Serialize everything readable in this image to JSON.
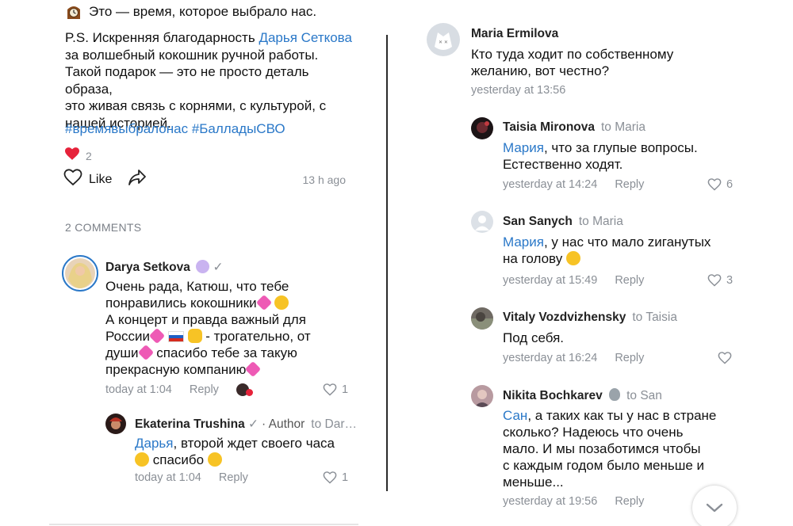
{
  "post": {
    "line_clock": "Это — время, которое выбрало нас.",
    "ps_prefix": "P.S. Искренняя благодарность ",
    "ps_mention": "Дарья Сеткова",
    "ps_line2": "за волшебный кокошник ручной работы.",
    "ps_line3": "Такой подарок — это не просто деталь образа,",
    "ps_line4": "это живая связь с корнями, с культурой, с",
    "ps_line5": "нашей историей.",
    "hashtags": "#времявыбралонас #БалладыСВО",
    "reaction_count": "2",
    "like_label": "Like",
    "time_ago": "13 h ago"
  },
  "comments_header": "2 COMMENTS",
  "left_comments": [
    {
      "author": "Darya Setkova",
      "lines": [
        "Очень рада, Катюш, что тебе",
        "понравились кокошники",
        "А концерт и правда важный для",
        "России",
        " - трогательно, от",
        "души",
        "спасибо тебе за такую",
        "прекрасную компанию"
      ],
      "time": "today at 1:04",
      "reply": "Reply",
      "likes": "1"
    },
    {
      "author": "Ekaterina Trushina",
      "role": "· Author",
      "to": "to Dar…",
      "mention": "Дарья",
      "text1": ", второй ждет своего часа",
      "text2": "спасибо",
      "time": "today at 1:04",
      "reply": "Reply",
      "likes": "1"
    }
  ],
  "right_comments": [
    {
      "author": "Maria Ermilova",
      "line1": "Кто туда ходит по собственному",
      "line2": "желанию, вот честно?",
      "time": "yesterday at 13:56"
    },
    {
      "author": "Taisia Mironova",
      "to": "to Maria",
      "mention": "Мария",
      "line1": ", что за глупые вопросы.",
      "line2": "Естественно ходят.",
      "time": "yesterday at 14:24",
      "reply": "Reply",
      "likes": "6"
    },
    {
      "author": "San Sanych",
      "to": "to Maria",
      "mention": "Мария",
      "line1": ", у нас что мало zиганутых",
      "line2": "на голову",
      "time": "yesterday at 15:49",
      "reply": "Reply",
      "likes": "3"
    },
    {
      "author": "Vitaly Vozdvizhensky",
      "to": "to Taisia",
      "line1": "Под себя.",
      "time": "yesterday at 16:24",
      "reply": "Reply"
    },
    {
      "author": "Nikita Bochkarev",
      "to": "to San",
      "mention": "Сан",
      "line1": ", а таких как ты у нас в стране",
      "line2": "сколько? Надеюсь что очень",
      "line3": "мало. И мы позаботимся чтобы",
      "line4": "с каждым годом было меньше и",
      "line5": "меньше...",
      "time": "yesterday at 19:56",
      "reply": "Reply"
    }
  ],
  "colors": {
    "link": "#2a78c8",
    "meta": "#8a8f96",
    "heart": "#e6223a",
    "divider": "#2a2a2a"
  },
  "icons": {
    "clock": "mantel-clock-icon",
    "heart": "heart-icon",
    "share": "share-icon",
    "chevron": "chevron-down-icon"
  }
}
